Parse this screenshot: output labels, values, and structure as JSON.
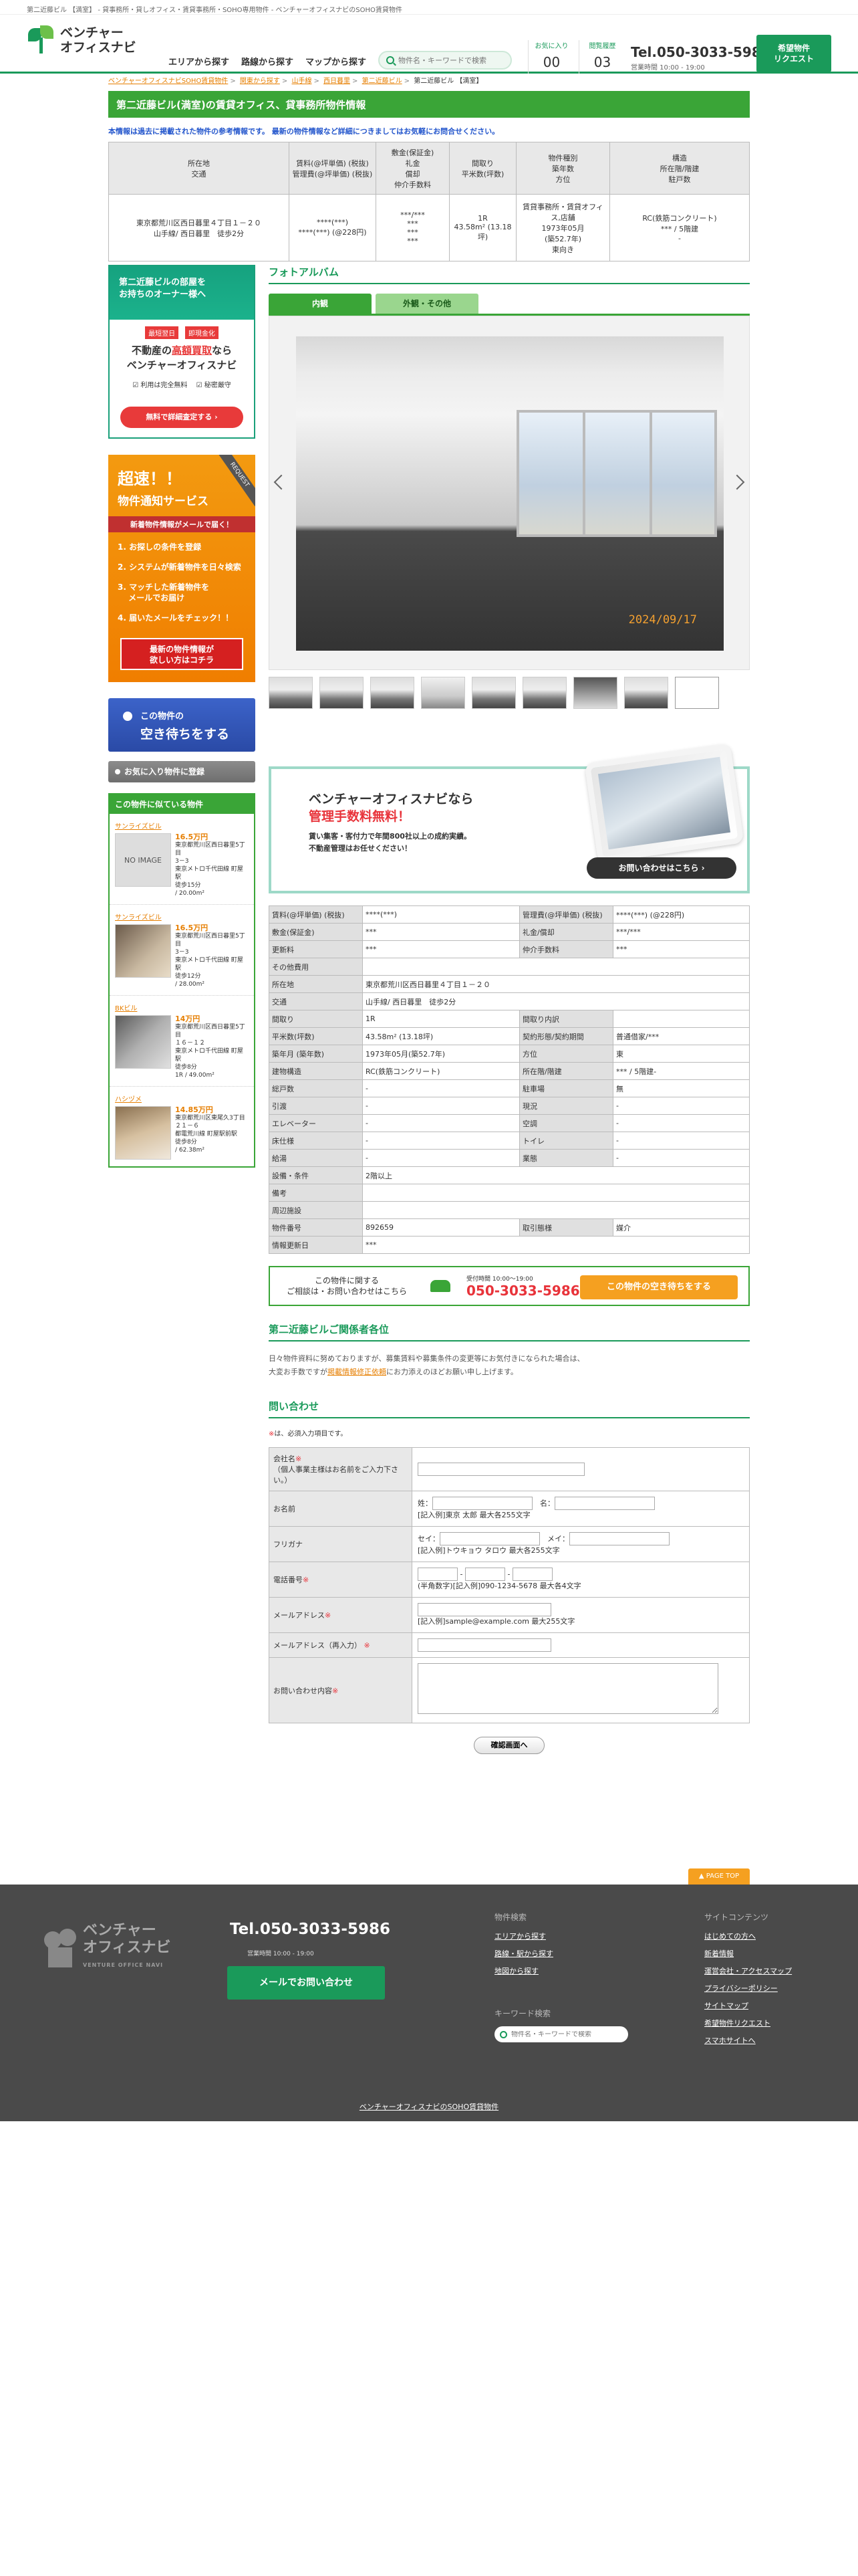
{
  "topline": "第二近藤ビル 【満室】 - 貸事務所・貸しオフィス・賃貸事務所・SOHO専用物件 - ベンチャーオフィスナビのSOHO賃貸物件",
  "header": {
    "logo_line1": "ベンチャー",
    "logo_line2": "オフィスナビ",
    "nav": [
      "エリアから探す",
      "路線から探す",
      "マップから探す"
    ],
    "search_placeholder": "物件名・キーワードで検索",
    "favorites_label": "お気に入り",
    "favorites_count": "00",
    "history_label": "閲覧履歴",
    "history_count": "03",
    "tel": "Tel.050-3033-5986",
    "hours": "営業時間 10:00 - 19:00",
    "request_button": "希望物件\nリクエスト"
  },
  "breadcrumb": [
    "ベンチャーオフィスナビSOHO賃貸物件",
    "関東から探す",
    "山手線",
    "西日暮里",
    "第二近藤ビル",
    "第二近藤ビル 【満室】"
  ],
  "title": "第二近藤ビル(満室)の賃貸オフィス、貸事務所物件情報",
  "notice": "本情報は過去に掲載された物件の参考情報です。 最新の物件情報など詳細につきましてはお気軽にお問合せください。",
  "summary": {
    "headers": [
      "所在地\n交通",
      "賃料(@坪単価) (税抜)\n管理費(@坪単価) (税抜)",
      "敷金(保証金)\n礼金\n償却\n仲介手数料",
      "間取り\n平米数(坪数)",
      "物件種別\n築年数\n方位",
      "構造\n所在階/階建\n駐戸数"
    ],
    "values": [
      "東京都荒川区西日暮里４丁目１－２０\n山手線/ 西日暮里　徒歩2分",
      "****(***)\n****(***) (@228円)",
      "***/***\n***\n***\n***",
      "1R\n43.58m² (13.18坪)",
      "賃貸事務所・賃貸オフィス,店舗\n1973年05月\n(築52.7年)\n東向き",
      "RC(鉄筋コンクリート)\n*** / 5階建\n-"
    ]
  },
  "sidebar": {
    "owner_banner": {
      "line1": "第二近藤ビルの部屋を",
      "line2": "お持ちのオーナー様へ",
      "tag1": "最短翌日",
      "tag2": "即現金化",
      "big1_a": "不動産の",
      "big1_b": "高額買取",
      "big1_c": "なら",
      "big2": "ベンチャーオフィスナビ",
      "check1": "☑ 利用は完全無料",
      "check2": "☑ 秘密厳守",
      "cta": "無料で詳細査定する ›"
    },
    "notify_banner": {
      "h1": "超速！！",
      "h2": "物件通知サービス",
      "ribbon": "REQUEST",
      "bar": "新着物件情報がメールで届く！",
      "steps": [
        "1. お探しの条件を登録",
        "2. システムが新着物件を日々検索",
        "3. マッチした新着物件を\n　 メールでお届け",
        "4. 届いたメールをチェック！！"
      ],
      "cta": "最新の物件情報が\n欲しい方はコチラ"
    },
    "wait_button_a": "この物件の",
    "wait_button_b": "空き待ちをする",
    "fav_button": "お気に入り物件に登録",
    "similar_title": "この物件に似ている物件",
    "similar": [
      {
        "name": "サンライズビル",
        "photo": "NO IMAGE",
        "price": "16.5万円",
        "info": "東京都荒川区西日暮里5丁目\n3－3\n東京メトロ千代田線 町屋駅\n徒歩15分\n/ 20.00m²"
      },
      {
        "name": "サンライズビル",
        "photo": "",
        "price": "16.5万円",
        "info": "東京都荒川区西日暮里5丁目\n3－3\n東京メトロ千代田線 町屋駅\n徒歩12分\n/ 28.00m²"
      },
      {
        "name": "BKビル",
        "photo": "",
        "price": "14万円",
        "info": "東京都荒川区西日暮里5丁目\n１６－１２\n東京メトロ千代田線 町屋駅\n徒歩8分\n1R / 49.00m²"
      },
      {
        "name": "ハシヅメ",
        "photo": "",
        "price": "14.85万円",
        "info": "東京都荒川区東尾久3丁目\n２１－６\n都電荒川線 町屋駅前駅\n徒歩8分\n/ 62.38m²"
      }
    ]
  },
  "main": {
    "album_title": "フォトアルバム",
    "tabs": [
      "内観",
      "外観・その他"
    ],
    "photo_date": "2024/09/17",
    "thumb_count": 9,
    "mgmt": {
      "t1": "ベンチャーオフィスナビなら",
      "t2": "管理手数料無料！",
      "t3": "賃い集客・客付力で年間800社以上の成約実績。\n不動産管理はお任せください！",
      "cta": "お問い合わせはこちら ›"
    },
    "detail": [
      [
        "賃料(@坪単価) (税抜)",
        "****(***)",
        "管理費(@坪単価) (税抜)",
        "****(***) (@228円)"
      ],
      [
        "敷金(保証金)",
        "***",
        "礼金/償却",
        "***/***"
      ],
      [
        "更新料",
        "***",
        "仲介手数料",
        "***"
      ],
      [
        "その他費用",
        "",
        "",
        ""
      ],
      [
        "所在地",
        "東京都荒川区西日暮里４丁目１－２０",
        "",
        ""
      ],
      [
        "交通",
        "山手線/ 西日暮里　徒歩2分",
        "",
        ""
      ],
      [
        "間取り",
        "1R",
        "間取り内訳",
        ""
      ],
      [
        "平米数(坪数)",
        "43.58m² (13.18坪)",
        "契約形態/契約期間",
        "普通借家/***"
      ],
      [
        "築年月 (築年数)",
        "1973年05月(築52.7年)",
        "方位",
        "東"
      ],
      [
        "建物構造",
        "RC(鉄筋コンクリート)",
        "所在階/階建",
        "*** / 5階建-"
      ],
      [
        "総戸数",
        "-",
        "駐車場",
        "無"
      ],
      [
        "引渡",
        "-",
        "現況",
        "-"
      ],
      [
        "エレベーター",
        "-",
        "空調",
        "-"
      ],
      [
        "床仕様",
        "-",
        "トイレ",
        "-"
      ],
      [
        "給湯",
        "-",
        "業態",
        "-"
      ],
      [
        "設備・条件",
        "2階以上",
        "",
        ""
      ],
      [
        "備考",
        "",
        "",
        ""
      ],
      [
        "周辺施設",
        "",
        "",
        ""
      ],
      [
        "物件番号",
        "892659",
        "取引態様",
        "媒介"
      ],
      [
        "情報更新日",
        "***",
        "",
        ""
      ]
    ],
    "contact_q": "この物件に関する\nご相談は・お問い合わせはこちら",
    "contact_hours": "受付時間 10:00～19:00",
    "contact_tel": "050-3033-5986",
    "contact_wait": "この物件の空き待ちをする",
    "related_title": "第二近藤ビルご関係者各位",
    "related_text1": "日々物件資料に努めておりますが、募集賃料や募集条件の変更等にお気付きになられた場合は、",
    "related_text2a": "大変お手数ですが",
    "related_text2b": "掲載情報修正依頼",
    "related_text2c": "にお力添えのほどお願い申し上げます。",
    "form_title": "問い合わせ",
    "required_note": "は、必須入力項目です。",
    "form": {
      "company_label": "会社名",
      "company_note": "（個人事業主様はお名前をご入力下さい。）",
      "name_label": "お名前",
      "sei": "姓：",
      "mei": "名：",
      "name_example": "[記入例]東京 太郎 最大各255文字",
      "kana_label": "フリガナ",
      "sei_kana": "セイ：",
      "mei_kana": "メイ：",
      "kana_example": "[記入例]トウキョウ タロウ 最大各255文字",
      "phone_label": "電話番号",
      "phone_example": "(半角数字)[記入例]090-1234-5678 最大各4文字",
      "email_label": "メールアドレス",
      "email_example": "[記入例]sample@example.com 最大255文字",
      "email2_label": "メールアドレス（再入力）",
      "message_label": "お問い合わせ内容",
      "confirm": "確認画面へ"
    }
  },
  "pagetop": "▲ PAGE TOP",
  "footer": {
    "logo_line1": "ベンチャー",
    "logo_line2": "オフィスナビ",
    "logo_sub": "VENTURE OFFICE NAVI",
    "tel": "Tel.050-3033-5986",
    "hours": "営業時間 10:00 - 19:00",
    "mail_button": "メールでお問い合わせ",
    "col1_title": "物件検索",
    "col1": [
      "エリアから探す",
      "路線・駅から探す",
      "地図から探す"
    ],
    "keyword_title": "キーワード検索",
    "search_placeholder": "物件名・キーワードで検索",
    "col2_title": "サイトコンテンツ",
    "col2": [
      "はじめての方へ",
      "新着情報",
      "運営会社・アクセスマップ",
      "プライバシーポリシー",
      "サイトマップ",
      "希望物件リクエスト",
      "スマホサイトへ"
    ],
    "copyright": "ベンチャーオフィスナビのSOHO賃貸物件"
  }
}
